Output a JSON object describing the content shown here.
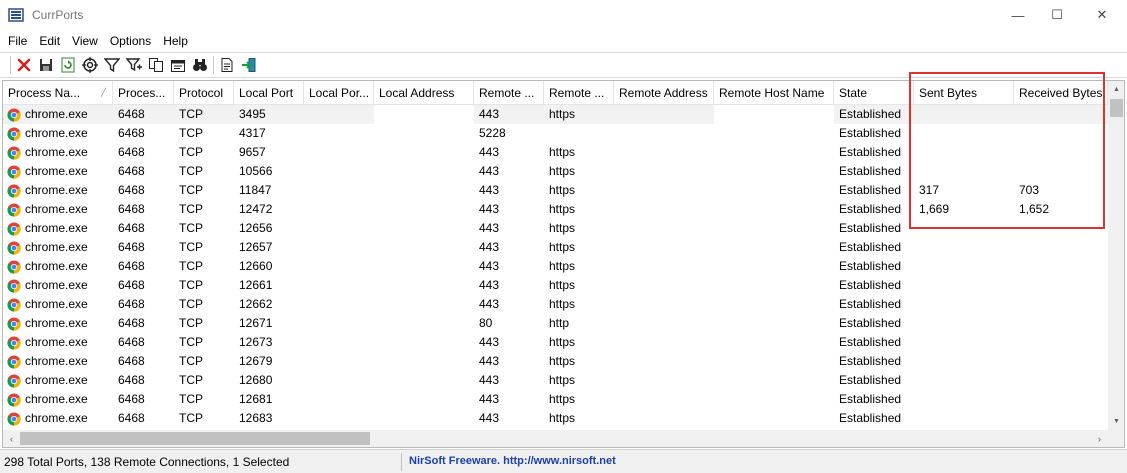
{
  "window": {
    "title": "CurrPorts",
    "min_glyph": "—",
    "max_glyph": "☐",
    "close_glyph": "✕"
  },
  "menu": [
    "File",
    "Edit",
    "View",
    "Options",
    "Help"
  ],
  "toolbar": {
    "buttons": [
      "close-connection",
      "save",
      "refresh",
      "properties",
      "filter",
      "advanced-filter",
      "copy",
      "html-report",
      "find",
      "report",
      "exit"
    ]
  },
  "columns": [
    {
      "label": "Process Na...",
      "width": 110
    },
    {
      "label": "Proces...",
      "width": 61
    },
    {
      "label": "Protocol",
      "width": 60
    },
    {
      "label": "Local Port",
      "width": 70
    },
    {
      "label": "Local Por...",
      "width": 70
    },
    {
      "label": "Local Address",
      "width": 100
    },
    {
      "label": "Remote ...",
      "width": 70
    },
    {
      "label": "Remote ...",
      "width": 70
    },
    {
      "label": "Remote Address",
      "width": 100
    },
    {
      "label": "Remote Host Name",
      "width": 120
    },
    {
      "label": "State",
      "width": 80
    },
    {
      "label": "Sent Bytes",
      "width": 100
    },
    {
      "label": "Received Bytes",
      "width": 94
    }
  ],
  "rows": [
    [
      "chrome.exe",
      "6468",
      "TCP",
      "3495",
      "",
      "",
      "443",
      "https",
      "",
      "",
      "Established",
      "",
      ""
    ],
    [
      "chrome.exe",
      "6468",
      "TCP",
      "4317",
      "",
      "",
      "5228",
      "",
      "",
      "",
      "Established",
      "",
      ""
    ],
    [
      "chrome.exe",
      "6468",
      "TCP",
      "9657",
      "",
      "",
      "443",
      "https",
      "",
      "",
      "Established",
      "",
      ""
    ],
    [
      "chrome.exe",
      "6468",
      "TCP",
      "10566",
      "",
      "",
      "443",
      "https",
      "",
      "",
      "Established",
      "",
      ""
    ],
    [
      "chrome.exe",
      "6468",
      "TCP",
      "11847",
      "",
      "",
      "443",
      "https",
      "",
      "",
      "Established",
      "317",
      "703"
    ],
    [
      "chrome.exe",
      "6468",
      "TCP",
      "12472",
      "",
      "",
      "443",
      "https",
      "",
      "",
      "Established",
      "1,669",
      "1,652"
    ],
    [
      "chrome.exe",
      "6468",
      "TCP",
      "12656",
      "",
      "",
      "443",
      "https",
      "",
      "",
      "Established",
      "",
      ""
    ],
    [
      "chrome.exe",
      "6468",
      "TCP",
      "12657",
      "",
      "",
      "443",
      "https",
      "",
      "",
      "Established",
      "",
      ""
    ],
    [
      "chrome.exe",
      "6468",
      "TCP",
      "12660",
      "",
      "",
      "443",
      "https",
      "",
      "",
      "Established",
      "",
      ""
    ],
    [
      "chrome.exe",
      "6468",
      "TCP",
      "12661",
      "",
      "",
      "443",
      "https",
      "",
      "",
      "Established",
      "",
      ""
    ],
    [
      "chrome.exe",
      "6468",
      "TCP",
      "12662",
      "",
      "",
      "443",
      "https",
      "",
      "",
      "Established",
      "",
      ""
    ],
    [
      "chrome.exe",
      "6468",
      "TCP",
      "12671",
      "",
      "",
      "80",
      "http",
      "",
      "",
      "Established",
      "",
      ""
    ],
    [
      "chrome.exe",
      "6468",
      "TCP",
      "12673",
      "",
      "",
      "443",
      "https",
      "",
      "",
      "Established",
      "",
      ""
    ],
    [
      "chrome.exe",
      "6468",
      "TCP",
      "12679",
      "",
      "",
      "443",
      "https",
      "",
      "",
      "Established",
      "",
      ""
    ],
    [
      "chrome.exe",
      "6468",
      "TCP",
      "12680",
      "",
      "",
      "443",
      "https",
      "",
      "",
      "Established",
      "",
      ""
    ],
    [
      "chrome.exe",
      "6468",
      "TCP",
      "12681",
      "",
      "",
      "443",
      "https",
      "",
      "",
      "Established",
      "",
      ""
    ],
    [
      "chrome.exe",
      "6468",
      "TCP",
      "12683",
      "",
      "",
      "443",
      "https",
      "",
      "",
      "Established",
      "",
      ""
    ]
  ],
  "selected_row": 0,
  "status": {
    "left": "298 Total Ports, 138 Remote Connections, 1 Selected",
    "right": "NirSoft Freeware.  http://www.nirsoft.net"
  },
  "colors": {
    "highlight": "#e03030",
    "link": "#1c3fa8"
  }
}
